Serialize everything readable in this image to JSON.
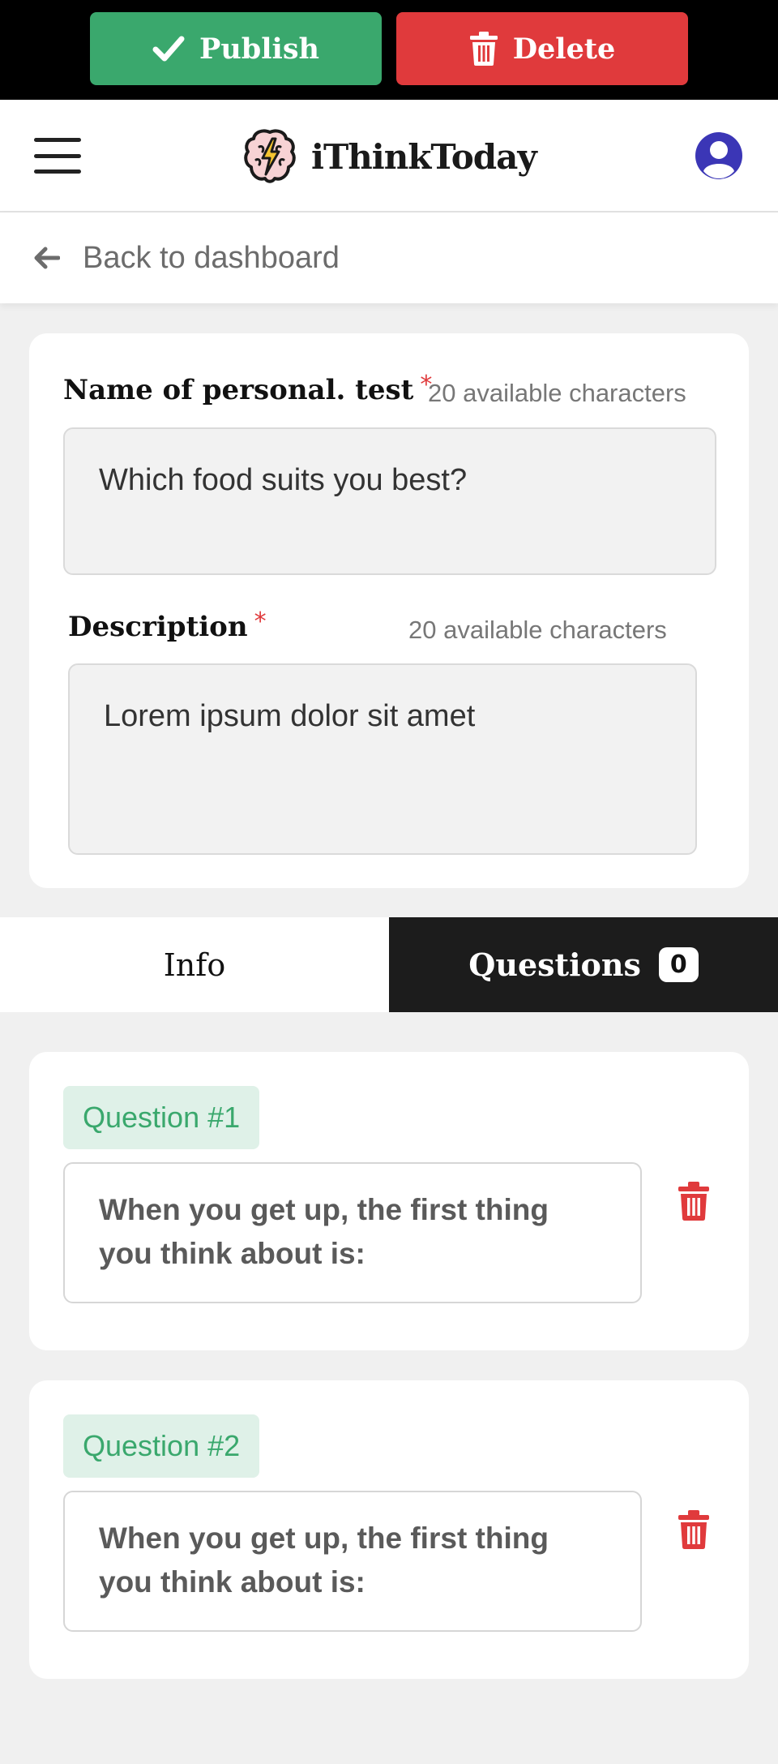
{
  "actions": {
    "publish_label": "Publish",
    "delete_label": "Delete"
  },
  "header": {
    "app_name": "iThinkToday"
  },
  "nav": {
    "back_label": "Back to dashboard"
  },
  "form": {
    "name_label": "Name of personal. test",
    "name_required": "*",
    "name_available": "20 available characters",
    "name_value": "Which food suits you best?",
    "description_label": "Description",
    "description_required": "*",
    "description_available": "20 available characters",
    "description_value": "Lorem ipsum dolor sit amet"
  },
  "tabs": {
    "info_label": "Info",
    "questions_label": "Questions",
    "questions_count": "0",
    "active": "questions"
  },
  "questions": [
    {
      "badge": "Question #1",
      "text": "When you get up, the first thing you think about is:"
    },
    {
      "badge": "Question #2",
      "text": "When you get up, the first thing you think about is:"
    }
  ],
  "colors": {
    "publish": "#3aa86d",
    "delete": "#e03a3c",
    "avatar": "#3b36b6",
    "active_tab": "#1c1c1c",
    "badge_bg": "#dff1e8"
  },
  "icons": {
    "publish": "check-icon",
    "delete": "trash-icon",
    "menu": "hamburger-menu-icon",
    "logo": "brain-lightning-logo",
    "avatar": "user-avatar-icon",
    "back": "arrow-left-icon",
    "remove_question": "trash-icon"
  }
}
